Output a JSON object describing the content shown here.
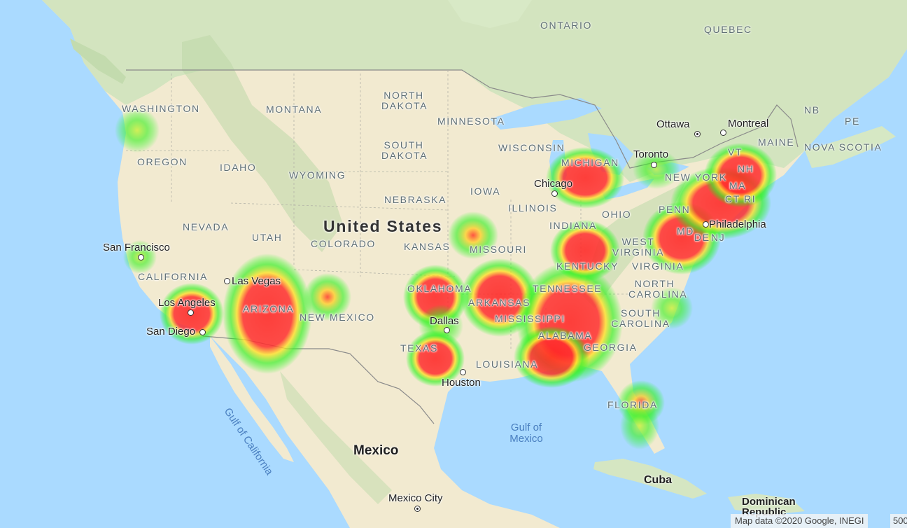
{
  "map": {
    "type": "heatmap-overlay",
    "base": "Google Maps terrain",
    "colors": {
      "water": "#aadaff",
      "land": "#f3ecd4",
      "forest": "#c8dfb4",
      "heat_low": "#00ff00",
      "heat_mid": "#ffff00",
      "heat_high": "#ff0000"
    }
  },
  "labels": {
    "us": "United States",
    "mexico": "Mexico",
    "cuba": "Cuba",
    "dominican": "Dominican Republic",
    "ontario": "ONTARIO",
    "quebec": "QUEBEC",
    "nb": "NB",
    "pe": "PE",
    "nova_scotia": "NOVA SCOTIA",
    "gulf_mexico": "Gulf of Mexico",
    "gulf_california": "Gulf of California"
  },
  "states": [
    {
      "key": "wa",
      "text": "WASHINGTON"
    },
    {
      "key": "or",
      "text": "OREGON"
    },
    {
      "key": "id",
      "text": "IDAHO"
    },
    {
      "key": "mt",
      "text": "MONTANA"
    },
    {
      "key": "wy",
      "text": "WYOMING"
    },
    {
      "key": "nd",
      "text": "NORTH DAKOTA"
    },
    {
      "key": "sd",
      "text": "SOUTH DAKOTA"
    },
    {
      "key": "ne",
      "text": "NEBRASKA"
    },
    {
      "key": "mn",
      "text": "MINNESOTA"
    },
    {
      "key": "wi",
      "text": "WISCONSIN"
    },
    {
      "key": "mi",
      "text": "MICHIGAN"
    },
    {
      "key": "ia",
      "text": "IOWA"
    },
    {
      "key": "il",
      "text": "ILLINOIS"
    },
    {
      "key": "in",
      "text": "INDIANA"
    },
    {
      "key": "oh",
      "text": "OHIO"
    },
    {
      "key": "ny",
      "text": "NEW YORK"
    },
    {
      "key": "vt",
      "text": "VT"
    },
    {
      "key": "nh",
      "text": "NH"
    },
    {
      "key": "me",
      "text": "MAINE"
    },
    {
      "key": "ma",
      "text": "MA"
    },
    {
      "key": "ctri",
      "text": "CT RI"
    },
    {
      "key": "pa",
      "text": "PENN"
    },
    {
      "key": "md",
      "text": "MD"
    },
    {
      "key": "de",
      "text": "DE"
    },
    {
      "key": "nj",
      "text": "NJ"
    },
    {
      "key": "wv",
      "text": "WEST VIRGINIA"
    },
    {
      "key": "va",
      "text": "VIRGINIA"
    },
    {
      "key": "ky",
      "text": "KENTUCKY"
    },
    {
      "key": "nc",
      "text": "NORTH CAROLINA"
    },
    {
      "key": "sc",
      "text": "SOUTH CAROLINA"
    },
    {
      "key": "tn",
      "text": "TENNESSEE"
    },
    {
      "key": "ga",
      "text": "GEORGIA"
    },
    {
      "key": "al",
      "text": "ALABAMA"
    },
    {
      "key": "ms",
      "text": "MISSISSIPPI"
    },
    {
      "key": "la",
      "text": "LOUISIANA"
    },
    {
      "key": "ar",
      "text": "ARKANSAS"
    },
    {
      "key": "mo",
      "text": "MISSOURI"
    },
    {
      "key": "ks",
      "text": "KANSAS"
    },
    {
      "key": "ok",
      "text": "OKLAHOMA"
    },
    {
      "key": "tx",
      "text": "TEXAS"
    },
    {
      "key": "nm",
      "text": "NEW MEXICO"
    },
    {
      "key": "co",
      "text": "COLORADO"
    },
    {
      "key": "ut",
      "text": "UTAH"
    },
    {
      "key": "nv",
      "text": "NEVADA"
    },
    {
      "key": "ca",
      "text": "CALIFORNIA"
    },
    {
      "key": "az",
      "text": "ARIZONA"
    },
    {
      "key": "fl",
      "text": "FLORIDA"
    }
  ],
  "cities": [
    {
      "key": "ottawa",
      "text": "Ottawa",
      "capital": true
    },
    {
      "key": "montreal",
      "text": "Montreal",
      "capital": false
    },
    {
      "key": "toronto",
      "text": "Toronto",
      "capital": false
    },
    {
      "key": "chicago",
      "text": "Chicago",
      "capital": false
    },
    {
      "key": "philadelphia",
      "text": "Philadelphia",
      "capital": false
    },
    {
      "key": "sf",
      "text": "San Francisco",
      "capital": false
    },
    {
      "key": "lv",
      "text": "Las Vegas",
      "capital": false
    },
    {
      "key": "la",
      "text": "Los Angeles",
      "capital": false
    },
    {
      "key": "sd",
      "text": "San Diego",
      "capital": false
    },
    {
      "key": "dallas",
      "text": "Dallas",
      "capital": false
    },
    {
      "key": "houston",
      "text": "Houston",
      "capital": false
    },
    {
      "key": "mexico_city",
      "text": "Mexico City",
      "capital": true
    }
  ],
  "heat_spots": [
    {
      "region": "Seattle, WA",
      "intensity": 0.35
    },
    {
      "region": "San Francisco, CA",
      "intensity": 0.2
    },
    {
      "region": "Los Angeles, CA",
      "intensity": 0.95
    },
    {
      "region": "Arizona",
      "intensity": 1.0
    },
    {
      "region": "Albuquerque, NM",
      "intensity": 0.6
    },
    {
      "region": "Oklahoma",
      "intensity": 0.95
    },
    {
      "region": "Dallas, TX",
      "intensity": 0.4
    },
    {
      "region": "Texas (Austin)",
      "intensity": 0.95
    },
    {
      "region": "Kansas City, MO",
      "intensity": 0.65
    },
    {
      "region": "Arkansas",
      "intensity": 1.0
    },
    {
      "region": "Tennessee / Alabama",
      "intensity": 1.0
    },
    {
      "region": "Gulf Coast AL/MS",
      "intensity": 1.0
    },
    {
      "region": "Kentucky",
      "intensity": 1.0
    },
    {
      "region": "Michigan",
      "intensity": 0.95
    },
    {
      "region": "Southern Ontario",
      "intensity": 0.25
    },
    {
      "region": "Maryland",
      "intensity": 1.0
    },
    {
      "region": "New England",
      "intensity": 1.0
    },
    {
      "region": "South Carolina coast",
      "intensity": 0.3
    },
    {
      "region": "Florida",
      "intensity": 0.7
    }
  ],
  "attribution": {
    "text": "Map data ©2020 Google, INEGI",
    "scale": "500"
  }
}
